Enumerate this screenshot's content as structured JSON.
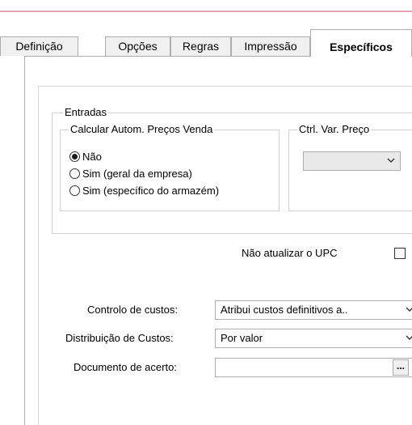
{
  "tabs": [
    {
      "label": "Definição"
    },
    {
      "label": "Opções"
    },
    {
      "label": "Regras"
    },
    {
      "label": "Impressão"
    },
    {
      "label": "Específicos"
    }
  ],
  "entradas": {
    "title": "Entradas",
    "calc_group": {
      "title": "Calcular Autom. Preços Venda",
      "options": [
        {
          "label": "Não",
          "checked": true
        },
        {
          "label": "Sim (geral da empresa)",
          "checked": false
        },
        {
          "label": "Sim (específico do armazém)",
          "checked": false
        }
      ]
    },
    "ctrl_group": {
      "title": "Ctrl. Var. Preço",
      "value": ""
    }
  },
  "upc": {
    "label": "Não atualizar o UPC",
    "checked": false
  },
  "fields": {
    "controlo_label": "Controlo de custos:",
    "controlo_value": "Atribui custos definitivos a..",
    "distribuicao_label": "Distribuição de Custos:",
    "distribuicao_value": "Por valor",
    "documento_label": "Documento de acerto:",
    "documento_value": "",
    "documento_button": "..."
  }
}
